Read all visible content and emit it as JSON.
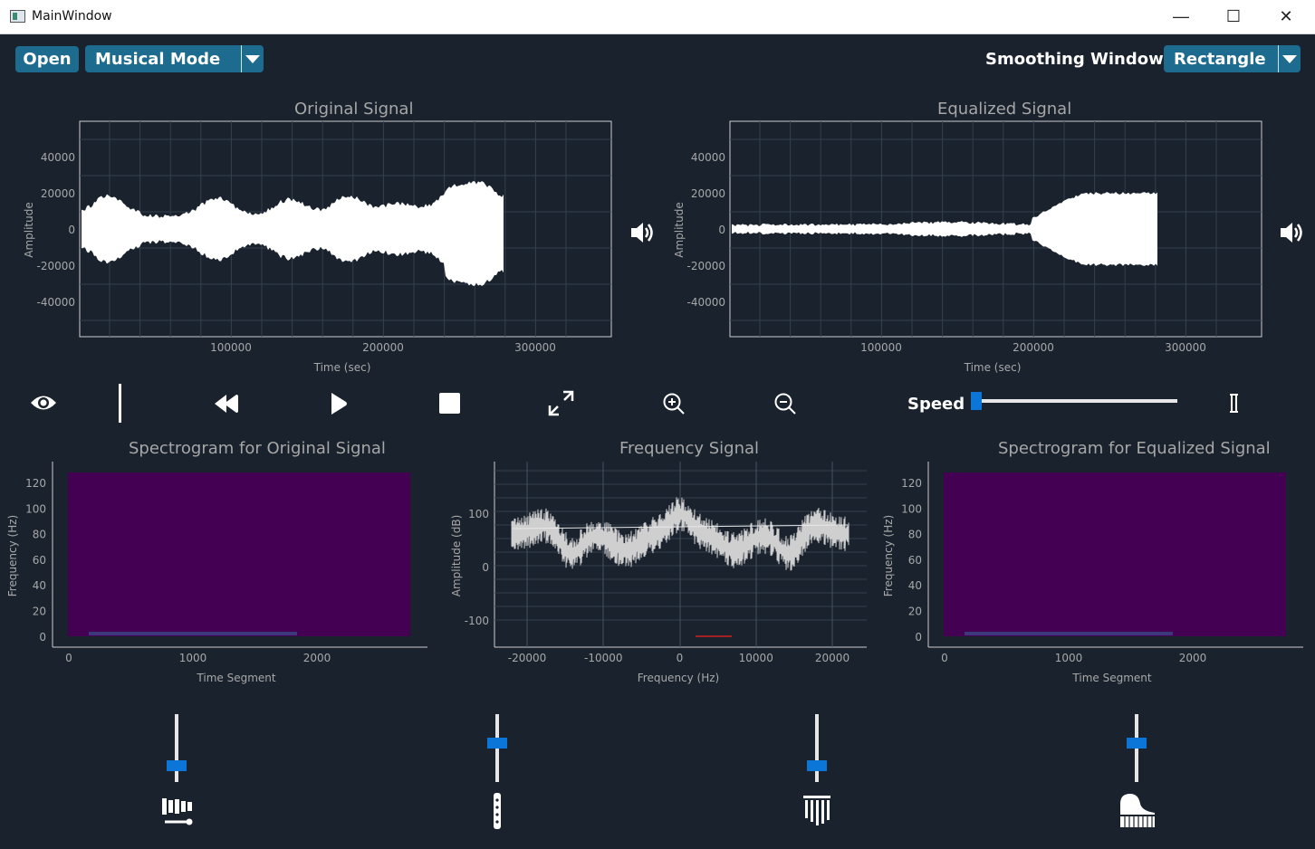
{
  "window": {
    "title": "MainWindow",
    "minimize": "—",
    "maximize": "☐",
    "close": "✕"
  },
  "toolbar": {
    "open_label": "Open",
    "mode_value": "Musical Mode",
    "smoothing_label": "Smoothing Window:",
    "smoothing_value": "Rectangle"
  },
  "plots": {
    "original": {
      "title": "Original Signal",
      "xlabel": "Time (sec)",
      "ylabel": "Amplitude",
      "yticks": [
        "40000",
        "20000",
        "0",
        "-20000",
        "-40000"
      ],
      "xticks": [
        "100000",
        "200000",
        "300000"
      ]
    },
    "equalized": {
      "title": "Equalized Signal",
      "xlabel": "Time (sec)",
      "ylabel": "Amplitude",
      "yticks": [
        "40000",
        "20000",
        "0",
        "-20000",
        "-40000"
      ],
      "xticks": [
        "100000",
        "200000",
        "300000"
      ]
    },
    "spec_original": {
      "title": "Spectrogram for Original Signal",
      "xlabel": "Time Segment",
      "ylabel": "Frequency (Hz)",
      "yticks": [
        "120",
        "100",
        "80",
        "60",
        "40",
        "20",
        "0"
      ],
      "xticks": [
        "0",
        "1000",
        "2000"
      ]
    },
    "frequency": {
      "title": "Frequency Signal",
      "xlabel": "Frequency (Hz)",
      "ylabel": "Amplitude (dB)",
      "yticks": [
        "100",
        "0",
        "-100"
      ],
      "xticks": [
        "-20000",
        "-10000",
        "0",
        "10000",
        "20000"
      ]
    },
    "spec_equalized": {
      "title": "Spectrogram for Equalized Signal",
      "xlabel": "Time Segment",
      "ylabel": "Frequency (Hz)",
      "yticks": [
        "120",
        "100",
        "80",
        "60",
        "40",
        "20",
        "0"
      ],
      "xticks": [
        "0",
        "1000",
        "2000"
      ]
    }
  },
  "controls": {
    "speed_label": "Speed",
    "speed_value": 0.0
  },
  "equalizer": [
    {
      "name": "xylophone",
      "level": 0.9,
      "icon": "xylophone-icon"
    },
    {
      "name": "flute",
      "level": 0.5,
      "icon": "flute-icon"
    },
    {
      "name": "chimes",
      "level": 0.9,
      "icon": "chimes-icon"
    },
    {
      "name": "piano",
      "level": 0.5,
      "icon": "piano-icon"
    }
  ],
  "colors": {
    "background": "#1a222d",
    "button": "#1d6b8f",
    "slider": "#0b76d8",
    "spectrogram": "#440154"
  }
}
